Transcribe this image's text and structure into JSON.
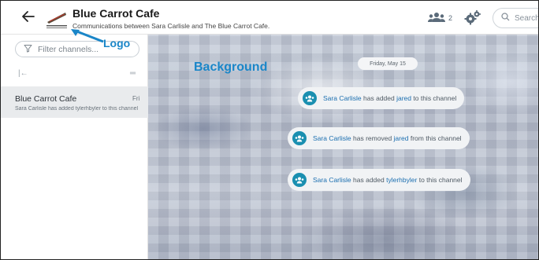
{
  "header": {
    "title": "Blue Carrot Cafe",
    "subtitle": "Communications between Sara Carlisle and The Blue Carrot Cafe.",
    "members_count": "2",
    "search_placeholder": "Search"
  },
  "sidebar": {
    "filter_placeholder": "Filter channels...",
    "channels": [
      {
        "name": "Blue Carrot Cafe",
        "day": "Fri",
        "preview": "Sara Carlisle has added tylerhbyler to this channel"
      }
    ]
  },
  "main": {
    "date": "Friday, May 15",
    "messages": [
      {
        "user": "Sara Carlisle",
        "action": "has added",
        "target": "jared",
        "suffix": "to this channel"
      },
      {
        "user": "Sara Carlisle",
        "action": "has removed",
        "target": "jared",
        "suffix": "from this channel"
      },
      {
        "user": "Sara Carlisle",
        "action": "has added",
        "target": "tylerhbyler",
        "suffix": "to this channel"
      }
    ]
  },
  "annotations": {
    "logo_label": "Logo",
    "background_label": "Background"
  },
  "colors": {
    "accent": "#1a8fb0",
    "link": "#1c6fb0",
    "annotation": "#1a86c8"
  },
  "icons": [
    "back-arrow-icon",
    "logo-image",
    "members-icon",
    "gear-icon",
    "search-icon",
    "filter-icon",
    "collapse-icon",
    "menu-icon",
    "group-icon"
  ]
}
